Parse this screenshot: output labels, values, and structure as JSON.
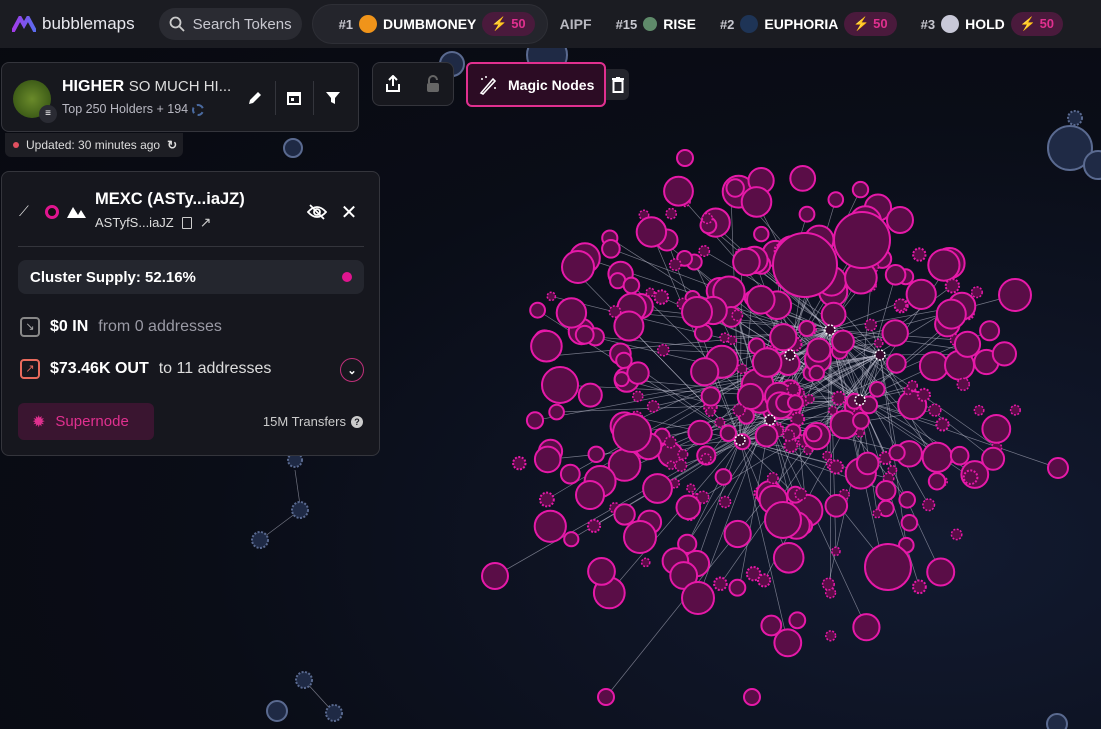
{
  "brand": {
    "name": "bubblemaps"
  },
  "search": {
    "placeholder": "Search Tokens"
  },
  "ticker": [
    {
      "rank": "#1",
      "name": "DUMBMONEY",
      "boost": "50",
      "color": "#f0941a"
    },
    {
      "rank": "",
      "name": "AIPF",
      "boost": null,
      "color": null
    },
    {
      "rank": "#15",
      "name": "RISE",
      "boost": null,
      "color": "#5f8a6a"
    },
    {
      "rank": "#2",
      "name": "EUPHORIA",
      "boost": "50",
      "color": "#1e3456"
    },
    {
      "rank": "#3",
      "name": "HOLD",
      "boost": "50",
      "color": "#c8c8d8"
    }
  ],
  "token": {
    "symbol": "HIGHER",
    "name": "SO MUCH HI...",
    "subtitle": "Top 250 Holders + 194",
    "updated": "Updated: 30 minutes ago"
  },
  "toolbar": {
    "magic_nodes": "Magic Nodes"
  },
  "details": {
    "title": "MEXC (ASTy...iaJZ)",
    "address": "ASTyfS...iaJZ",
    "cluster_supply": "Cluster Supply: 52.16%",
    "in_amount": "$0 IN",
    "in_desc": "from 0 addresses",
    "out_amount": "$73.46K OUT",
    "out_desc": "to 11 addresses",
    "supernode": "Supernode",
    "transfers": "15M Transfers"
  },
  "colors": {
    "accent": "#e0158f",
    "node_fill": "#5a0d47",
    "node_stroke": "#e619a8",
    "blue_node": "#1f2a45",
    "blue_stroke": "#5a6a90"
  }
}
